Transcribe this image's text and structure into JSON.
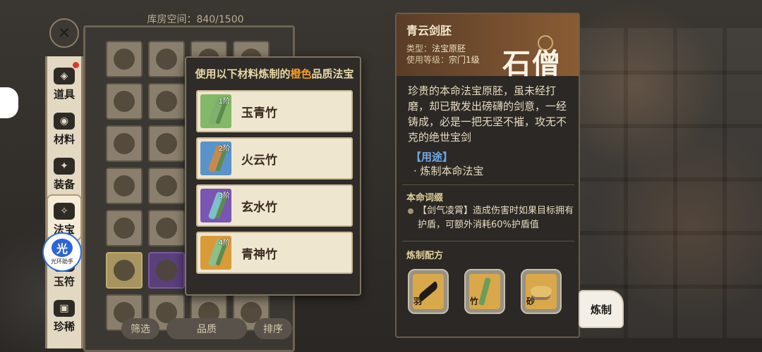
{
  "storage": {
    "title": "库房空间：840/1500",
    "filter_label": "筛选",
    "quality_label": "品质",
    "sort_label": "排序"
  },
  "categories": [
    {
      "label": "道具"
    },
    {
      "label": "材料"
    },
    {
      "label": "装备"
    },
    {
      "label": "法宝"
    },
    {
      "label": "玉符"
    },
    {
      "label": "珍稀"
    }
  ],
  "helper": {
    "label": "光环助手",
    "glyph": "光"
  },
  "popup": {
    "title_prefix": "使用以下材料炼制的",
    "title_highlight": "橙色",
    "title_suffix": "品质法宝",
    "materials": [
      {
        "tier": "1阶",
        "name": "玉青竹",
        "color": "#83b867"
      },
      {
        "tier": "2阶",
        "name": "火云竹",
        "color": "#5a93c9"
      },
      {
        "tier": "3阶",
        "name": "玄水竹",
        "color": "#7b55b3"
      },
      {
        "tier": "4阶",
        "name": "青神竹",
        "color": "#d99b3a"
      }
    ]
  },
  "detail": {
    "name": "青云剑胚",
    "type_key": "类型：",
    "type_value": "法宝原胚",
    "level_key": "使用等级：",
    "level_value": "宗门1级",
    "stamp": "石僧",
    "description": "珍贵的本命法宝原胚，虽未经打磨，却已散发出磅礴的剑意，一经铸成，必是一把无坚不摧，攻无不克的绝世宝剑",
    "usage_title": "【用途】",
    "usage_item": "· 炼制本命法宝",
    "affix_title": "本命词缀",
    "affix_text": "【剑气凌霄】造成伤害时如果目标拥有护盾，可额外消耗60%护盾值",
    "recipe_title": "炼制配方",
    "recipe": [
      {
        "label": "羽",
        "kind": "feather"
      },
      {
        "label": "竹",
        "kind": "bamboo"
      },
      {
        "label": "砂",
        "kind": "sand"
      }
    ]
  },
  "craft_button": "炼制",
  "colors": {
    "orange_quality": "#f59b23",
    "usage_blue": "#6fa9e6",
    "header_brown": "#8a5c35"
  }
}
